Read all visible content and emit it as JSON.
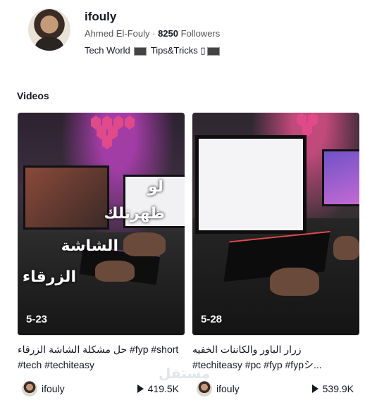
{
  "profile": {
    "username": "ifouly",
    "display_name": "Ahmed El-Fouly",
    "separator": "·",
    "followers_count": "8250",
    "followers_label": "Followers",
    "bio_part1": "Tech World",
    "bio_part2": "Tips&Tricks",
    "bio_glyph": "▯"
  },
  "section_title": "Videos",
  "videos": [
    {
      "duration": "5-23",
      "overlay_lines": [
        "لو",
        "ظهرتلك",
        "الشاشة",
        "الزرقاء"
      ],
      "description_ar": "حل مشكلة الشاشة الزرقاء",
      "description_tags_1": " #fyp #short",
      "description_tags_2": "#tech #techiteasy",
      "author": "ifouly",
      "plays": "419.5K"
    },
    {
      "duration": "5-28",
      "description_ar": "زرار الباور والكاننات الخفيه",
      "description_tags_2": "#techiteasy #pc #fyp #fypシ...",
      "author": "ifouly",
      "plays": "539.9K"
    }
  ],
  "watermark_text": "مستقل",
  "colors": {
    "text": "#161823",
    "muted": "#555555",
    "neon": "#e04a8a"
  }
}
